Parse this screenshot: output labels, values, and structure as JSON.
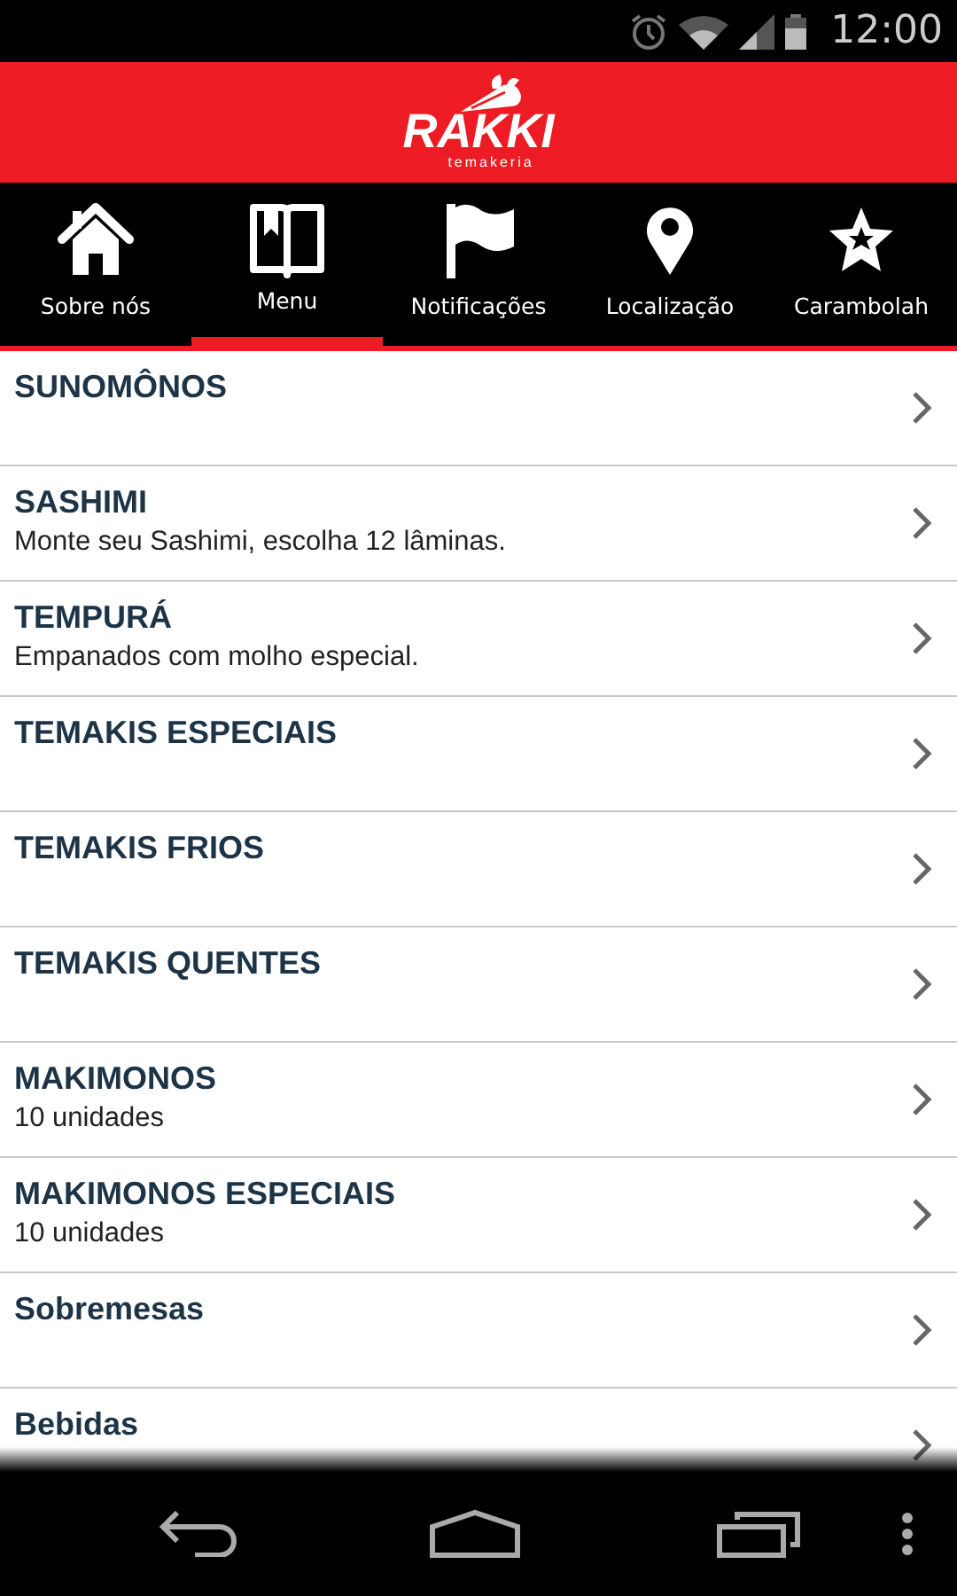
{
  "status_bar": {
    "time": "12:00"
  },
  "header": {
    "logo_text": "RAKKI",
    "logo_subtext": "temakeria"
  },
  "tabs": [
    {
      "label": "Sobre nós",
      "kind": "house",
      "selected": false
    },
    {
      "label": "Menu",
      "kind": "book",
      "selected": true
    },
    {
      "label": "Notificações",
      "kind": "flag",
      "selected": false
    },
    {
      "label": "Localização",
      "kind": "pin",
      "selected": false
    },
    {
      "label": "Carambolah",
      "kind": "star",
      "selected": false
    }
  ],
  "menu_items": [
    {
      "title": "SUNOMÔNOS"
    },
    {
      "title": "SASHIMI",
      "subtitle": "Monte seu Sashimi, escolha 12 lâminas."
    },
    {
      "title": "TEMPURÁ",
      "subtitle": "Empanados com molho especial."
    },
    {
      "title": "TEMAKIS ESPECIAIS"
    },
    {
      "title": "TEMAKIS FRIOS"
    },
    {
      "title": "TEMAKIS QUENTES"
    },
    {
      "title": "MAKIMONOS",
      "subtitle": "10 unidades"
    },
    {
      "title": "MAKIMONOS ESPECIAIS",
      "subtitle": "10 unidades"
    },
    {
      "title": "Sobremesas"
    },
    {
      "title": "Bebidas"
    }
  ]
}
